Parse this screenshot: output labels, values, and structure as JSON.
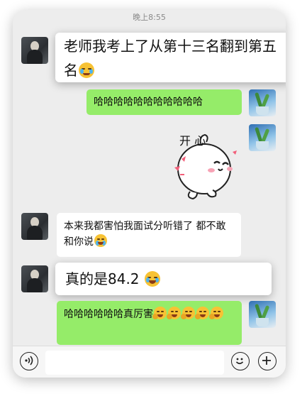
{
  "chat": {
    "timestamp": "晚上8:55",
    "messages": [
      {
        "side": "left",
        "style": "highlight",
        "text": "老师我考上了从第十三名翻到第五名",
        "emoji": "crying-face-icon"
      },
      {
        "side": "right",
        "text": "哈哈哈哈哈哈哈哈哈哈哈"
      },
      {
        "side": "right",
        "type": "sticker",
        "sticker_text": "开 心"
      },
      {
        "side": "left",
        "text": "本来我都害怕我面试分听错了  都不敢和你说",
        "emoji": "crying-laughing-face-icon"
      },
      {
        "side": "left",
        "style": "highlight",
        "text": "真的是84.2",
        "emoji": "crying-laughing-face-icon"
      },
      {
        "side": "right",
        "text": "哈哈哈哈哈哈真厉害",
        "emoji": "laughing-face-icon",
        "emoji_count": 5
      }
    ]
  },
  "input_bar": {
    "voice_icon": "voice-icon",
    "emoji_icon": "emoji-icon",
    "plus_icon": "plus-icon",
    "placeholder": ""
  },
  "colors": {
    "chat_background": "#ededed",
    "sent_bubble": "#95ec69",
    "received_bubble": "#ffffff"
  }
}
